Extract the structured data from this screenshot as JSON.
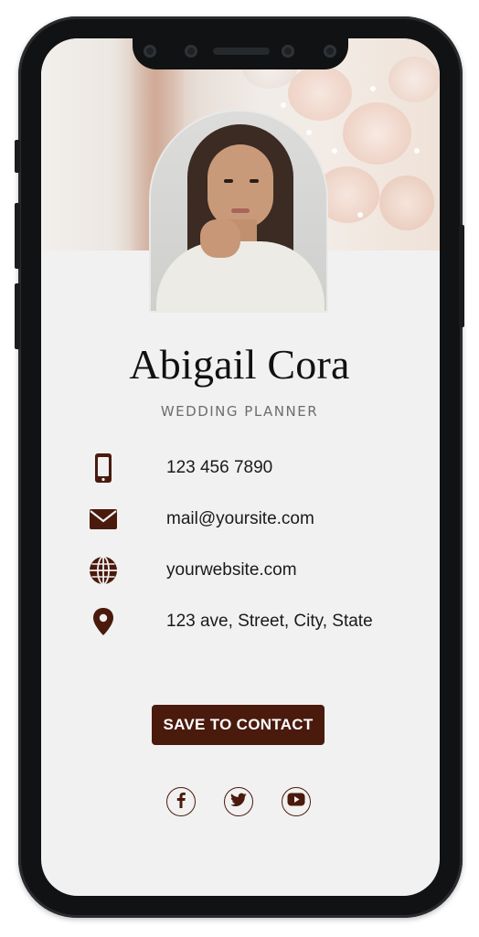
{
  "profile": {
    "name": "Abigail Cora",
    "title": "WEDDING PLANNER"
  },
  "contacts": [
    {
      "icon": "phone-icon",
      "text": "123 456 7890"
    },
    {
      "icon": "mail-icon",
      "text": "mail@yoursite.com"
    },
    {
      "icon": "globe-icon",
      "text": "yourwebsite.com"
    },
    {
      "icon": "location-pin-icon",
      "text": "123 ave, Street, City, State"
    }
  ],
  "actions": {
    "save_label": "SAVE TO CONTACT"
  },
  "social": [
    {
      "icon": "facebook-icon"
    },
    {
      "icon": "twitter-icon"
    },
    {
      "icon": "youtube-icon"
    }
  ],
  "colors": {
    "accent": "#4a1a0d",
    "screen_bg": "#f1f1f1",
    "phone_frame": "#111214"
  }
}
